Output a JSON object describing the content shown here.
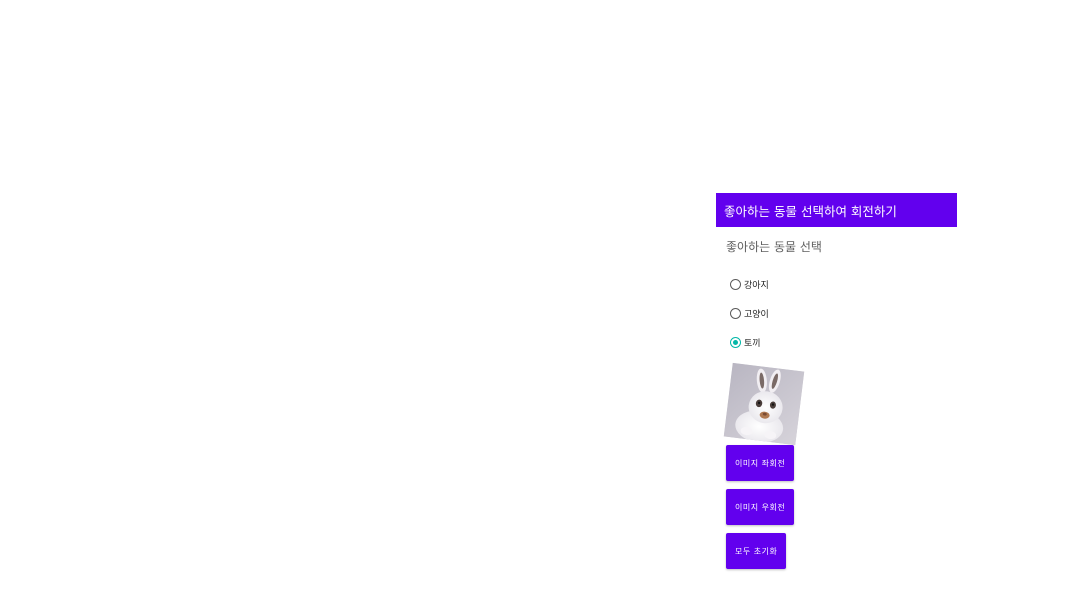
{
  "app_bar": {
    "title": "좋아하는 동물 선택하여 회전하기",
    "color": "#6200ee"
  },
  "section": {
    "label": "좋아하는 동물 선택"
  },
  "radio_options": [
    {
      "label": "강아지",
      "checked": false
    },
    {
      "label": "고양이",
      "checked": false
    },
    {
      "label": "토끼",
      "checked": true
    }
  ],
  "accent_color": "#03b8a8",
  "image": {
    "subject": "rabbit-photo",
    "rotation_deg": 7
  },
  "buttons": {
    "rotate_left": "이미지 좌회전",
    "rotate_right": "이미지 우회전",
    "reset": "모두 초기화"
  }
}
